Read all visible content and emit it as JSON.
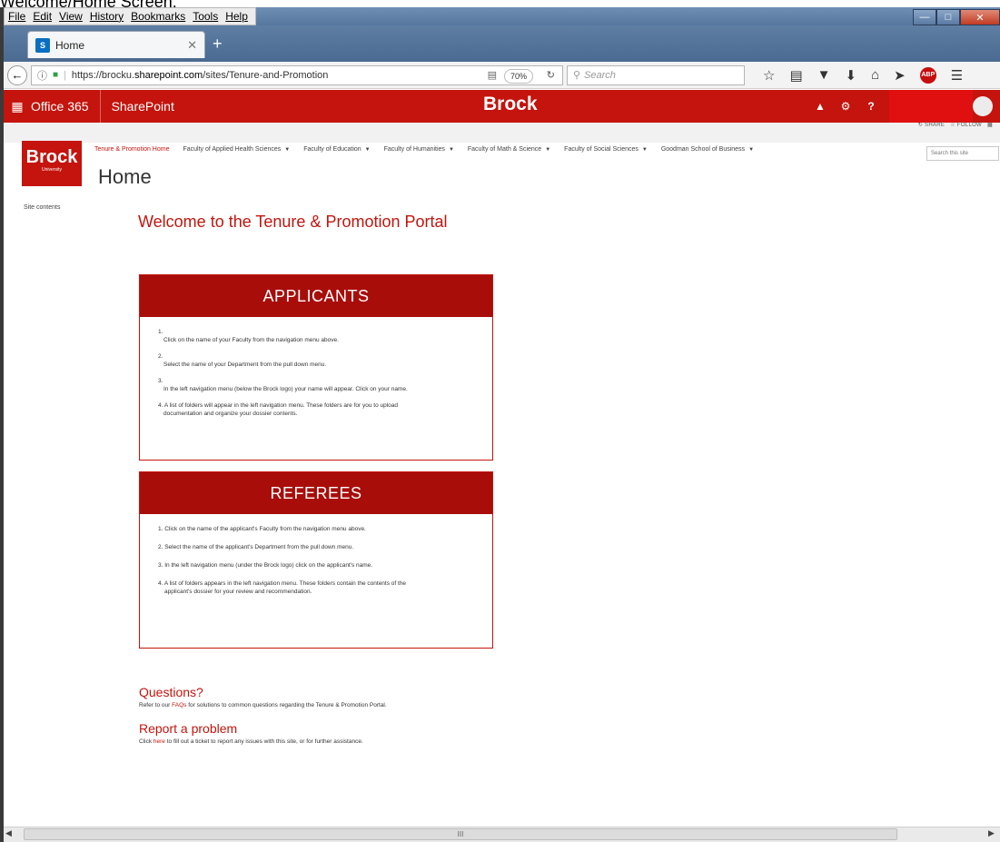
{
  "caption": "Welcome/Home Screen:",
  "browser": {
    "menu": [
      "File",
      "Edit",
      "View",
      "History",
      "Bookmarks",
      "Tools",
      "Help"
    ],
    "tab_title": "Home",
    "tab_icon_text": "S",
    "new_tab": "+",
    "url_prefix": "https://brocku.",
    "url_host": "sharepoint.com",
    "url_path": "/sites/Tenure-and-Promotion",
    "zoom": "70%",
    "search_placeholder": "Search"
  },
  "suitebar": {
    "app_launcher": "waffle-icon",
    "office365": "Office 365",
    "sharepoint": "SharePoint",
    "brand": "Brock",
    "help": "?"
  },
  "actions": {
    "share": "SHARE",
    "follow": "FOLLOW"
  },
  "site": {
    "logo_text": "Brock",
    "logo_sub": "University",
    "page_title": "Home",
    "search_placeholder": "Search this site",
    "nav": {
      "home": "Tenure & Promotion Home",
      "items": [
        "Faculty of Applied Health Sciences",
        "Faculty of Education",
        "Faculty of Humanities",
        "Faculty of Math & Science",
        "Faculty of Social Sciences",
        "Goodman School of Business"
      ]
    },
    "left_nav": "Site contents"
  },
  "content": {
    "welcome": "Welcome to the Tenure & Promotion Portal",
    "applicants": {
      "heading": "APPLICANTS",
      "steps": [
        {
          "num": "1.",
          "text": "Click on the name of your Faculty from the navigation menu above."
        },
        {
          "num": "2.",
          "text": "Select the name of your Department from the pull down menu."
        },
        {
          "num": "3.",
          "text": "In the left navigation menu (below the Brock logo) your name will appear. Click on your name."
        }
      ],
      "step4_line1": "4. A list of folders will appear in the left navigation menu. These folders are for you to upload",
      "step4_line2": "documentation and organize your dossier contents."
    },
    "referees": {
      "heading": "REFEREES",
      "step1": "1. Click on the name of the applicant's Faculty from the navigation menu above.",
      "step2": "2. Select the name of the applicant's Department from the pull down menu.",
      "step3": "3. In the left navigation menu (under the Brock logo) click on the applicant's name.",
      "step4_line1": "4. A list of folders appears in the left navigation menu. These folders contain the contents of the",
      "step4_line2": "applicant's dossier for your review and recommendation."
    },
    "questions": {
      "heading": "Questions?",
      "pre": "Refer to our ",
      "link": "FAQs",
      "post": " for solutions to common questions regarding the Tenure & Promotion Portal."
    },
    "report": {
      "heading": "Report a problem",
      "pre": "Click ",
      "link": "here",
      "post": " to fill out a ticket to report any issues with this site, or for further assistance."
    }
  },
  "scrollbar": {
    "thumb_grip": "III"
  }
}
